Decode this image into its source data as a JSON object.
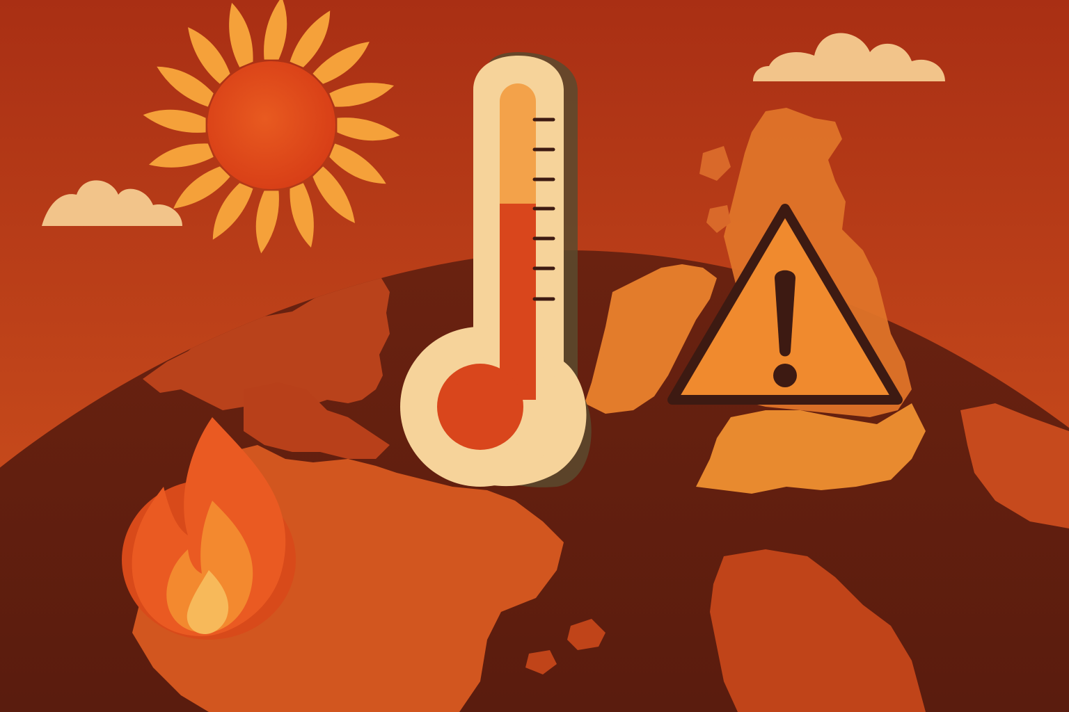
{
  "illustration": {
    "elements": [
      "sun-icon",
      "cloud-icon",
      "thermometer-icon",
      "warning-icon",
      "fire-icon",
      "globe",
      "map-landmasses"
    ],
    "thermometer_fill_fraction": 0.62,
    "colors": {
      "sky_top": "#a92f14",
      "sky_bottom": "#d4561f",
      "sun_core": "#e2471a",
      "sun_rays": "#f5a13a",
      "cloud": "#f2c48a",
      "globe_ocean": "#6e2412",
      "land_warm": "#c54a1e",
      "land_hot": "#e07a2a",
      "thermometer_body": "#f6d39a",
      "thermometer_mercury": "#d9461c",
      "warning_fill": "#f08a2e",
      "warning_stroke": "#3d1a12",
      "flame_outer": "#e8501d",
      "flame_mid": "#f3892f",
      "flame_core": "#f7b95a"
    }
  }
}
